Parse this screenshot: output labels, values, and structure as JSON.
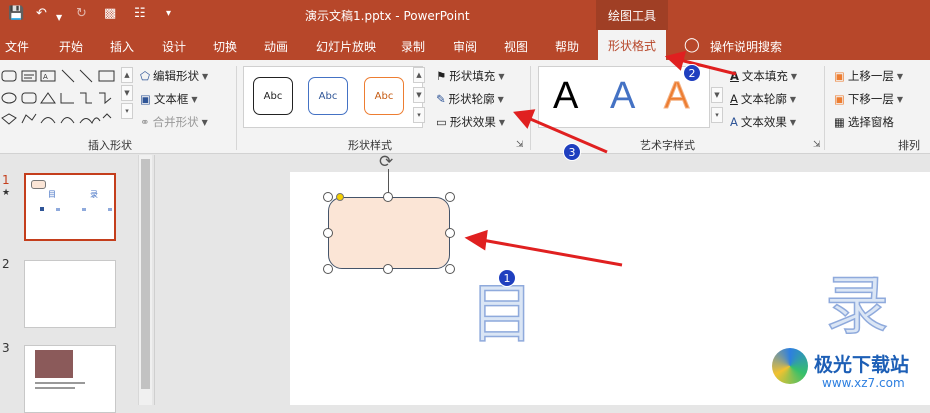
{
  "window": {
    "title": "演示文稿1.pptx  -  PowerPoint",
    "context_tool": "绘图工具",
    "quick_access": [
      "save-icon",
      "undo-icon",
      "redo-icon",
      "from-start-icon",
      "preview-icon",
      "customize-icon"
    ]
  },
  "tabs": [
    "文件",
    "开始",
    "插入",
    "设计",
    "切换",
    "动画",
    "幻灯片放映",
    "录制",
    "审阅",
    "视图",
    "帮助",
    "形状格式"
  ],
  "active_tab": "形状格式",
  "tell_me": "操作说明搜索",
  "ribbon": {
    "insert_shapes": {
      "label": "插入形状",
      "edit_shape": "编辑形状",
      "text_box": "文本框",
      "merge_shapes": "合并形状"
    },
    "shape_styles": {
      "label": "形状样式",
      "samples": [
        "Abc",
        "Abc",
        "Abc"
      ],
      "sample_colors": [
        "#222222",
        "#4472c4",
        "#ed7d31"
      ],
      "fill": "形状填充",
      "outline": "形状轮廓",
      "effects": "形状效果"
    },
    "wordart": {
      "label": "艺术字样式",
      "samples": [
        "A",
        "A",
        "A"
      ],
      "sample_colors": [
        "#000000",
        "#4472c4",
        "#ed7d31"
      ],
      "text_fill": "文本填充",
      "text_outline": "文本轮廓",
      "text_effects": "文本效果"
    },
    "arrange": {
      "label": "排列",
      "bring_forward": "上移一层",
      "send_backward": "下移一层",
      "selection_pane": "选择窗格"
    }
  },
  "slides": [
    {
      "number": "1",
      "star": "★",
      "text_a": "目",
      "text_b": "录"
    },
    {
      "number": "2"
    },
    {
      "number": "3"
    }
  ],
  "slide_canvas": {
    "char_1": "目",
    "char_2": "录",
    "shape_fill": "#fbe5d6",
    "shape_border": "#44546a"
  },
  "annotations": [
    "1",
    "2",
    "3"
  ],
  "watermark": {
    "name": "极光下载站",
    "url": "www.xz7.com"
  }
}
